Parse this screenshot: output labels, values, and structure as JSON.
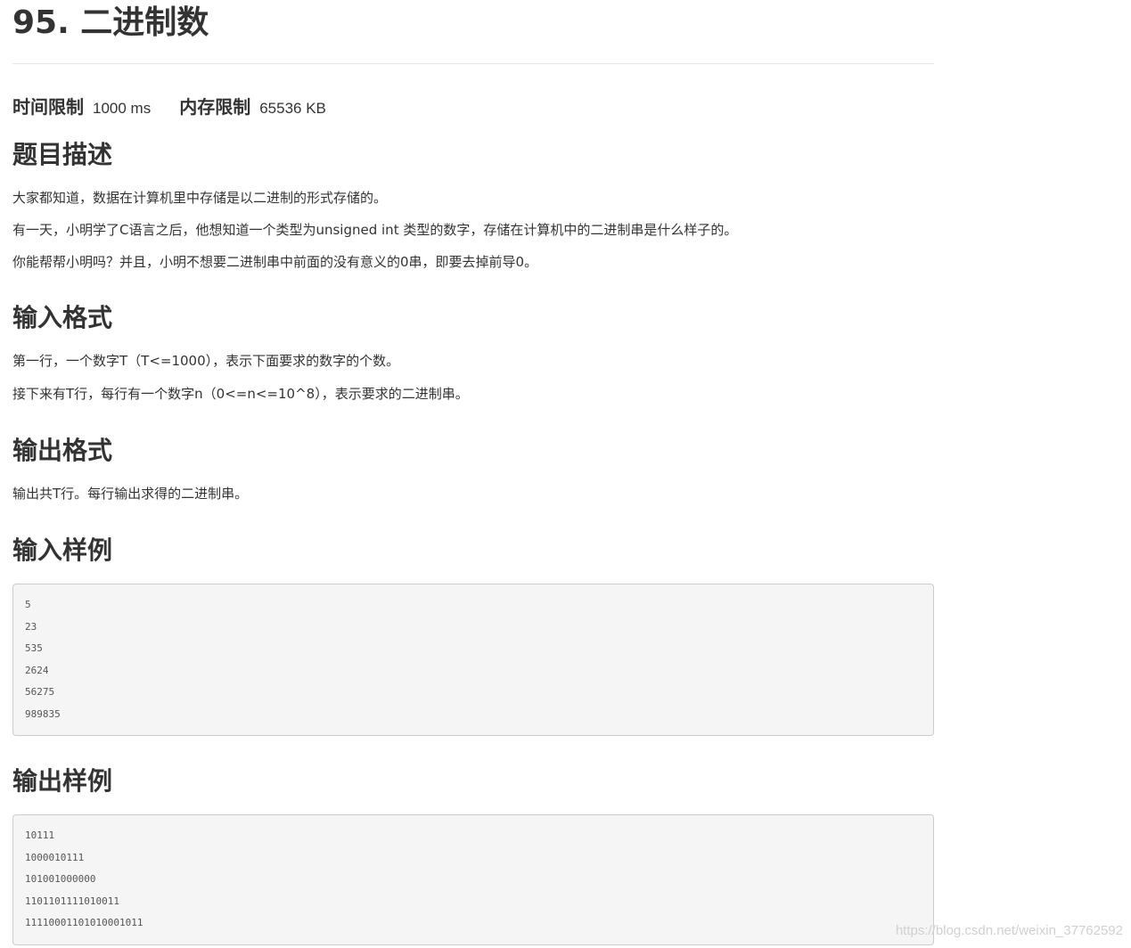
{
  "problem": {
    "title": "95. 二进制数"
  },
  "limits": {
    "time_label": "时间限制",
    "time_value": "1000 ms",
    "memory_label": "内存限制",
    "memory_value": "65536 KB"
  },
  "description": {
    "heading": "题目描述",
    "paragraphs": [
      "大家都知道，数据在计算机里中存储是以二进制的形式存储的。",
      "有一天，小明学了C语言之后，他想知道一个类型为unsigned int 类型的数字，存储在计算机中的二进制串是什么样子的。",
      "你能帮帮小明吗？并且，小明不想要二进制串中前面的没有意义的0串，即要去掉前导0。"
    ]
  },
  "input_format": {
    "heading": "输入格式",
    "paragraphs": [
      "第一行，一个数字T（T<=1000），表示下面要求的数字的个数。",
      "接下来有T行，每行有一个数字n（0<=n<=10^8），表示要求的二进制串。"
    ]
  },
  "output_format": {
    "heading": "输出格式",
    "paragraphs": [
      "输出共T行。每行输出求得的二进制串。"
    ]
  },
  "sample_input": {
    "heading": "输入样例",
    "lines": [
      "5",
      "23",
      "535",
      "2624",
      "56275",
      "989835"
    ]
  },
  "sample_output": {
    "heading": "输出样例",
    "lines": [
      "10111",
      "1000010111",
      "101001000000",
      "1101101111010011",
      "11110001101010001011"
    ]
  },
  "watermark": "https://blog.csdn.net/weixin_37762592"
}
